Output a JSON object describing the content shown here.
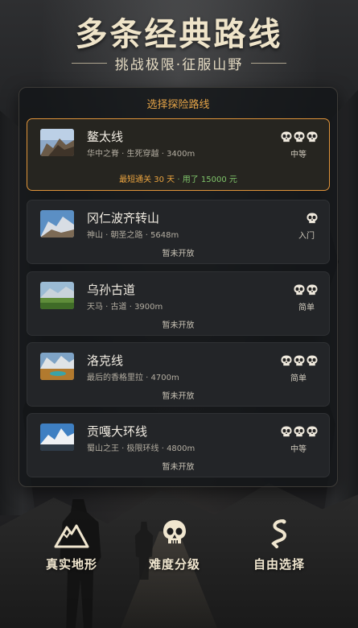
{
  "header": {
    "title": "多条经典路线",
    "subtitle": "挑战极限·征服山野"
  },
  "panel": {
    "title": "选择探险路线"
  },
  "routes": [
    {
      "name": "鳌太线",
      "desc": "华中之脊 · 生死穿越 · 3400m",
      "skulls": 3,
      "difficulty": "中等",
      "record_a": "最短通关 30 天",
      "record_sep": " · ",
      "record_b": "用了 15000 元",
      "selected": true
    },
    {
      "name": "冈仁波齐转山",
      "desc": "神山 · 朝圣之路 · 5648m",
      "skulls": 1,
      "difficulty": "入门",
      "status": "暂未开放"
    },
    {
      "name": "乌孙古道",
      "desc": "天马 · 古道 · 3900m",
      "skulls": 2,
      "difficulty": "简单",
      "status": "暂未开放"
    },
    {
      "name": "洛克线",
      "desc": "最后的香格里拉 · 4700m",
      "skulls": 3,
      "difficulty": "简单",
      "status": "暂未开放"
    },
    {
      "name": "贡嘎大环线",
      "desc": "蜀山之王 · 极限环线 · 4800m",
      "skulls": 3,
      "difficulty": "中等",
      "status": "暂未开放"
    }
  ],
  "features": [
    {
      "label": "真实地形",
      "icon": "mountain-icon"
    },
    {
      "label": "难度分级",
      "icon": "skull-icon"
    },
    {
      "label": "自由选择",
      "icon": "path-icon"
    }
  ],
  "colors": {
    "accent": "#e0943a",
    "record_time": "#e9a33f",
    "record_cost": "#7fc46a"
  }
}
